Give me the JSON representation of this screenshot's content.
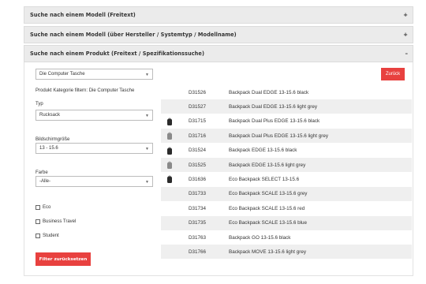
{
  "accordion": [
    {
      "title": "Suche nach einem Modell (Freitext)",
      "toggle": "+"
    },
    {
      "title": "Suche nach einem Modell (über Hersteller / Systemtyp / Modellname)",
      "toggle": "+"
    },
    {
      "title": "Suche nach einem Produkt (Freitext / Spezifikationssuche)",
      "toggle": "–"
    }
  ],
  "filters": {
    "category_select": "Die Computer Tasche",
    "category_filter_text": "Produkt Kategorie filtern: Die Computer Tasche",
    "typ_label": "Typ",
    "typ_value": "Rucksack",
    "screen_label": "Bildschirmgröße",
    "screen_value": "13 - 15.6",
    "color_label": "Farbe",
    "color_value": "-Alle-",
    "checkboxes": [
      "Eco",
      "Business Travel",
      "Student"
    ],
    "reset_label": "Filter zurücksetzen",
    "caret": "▼"
  },
  "back_label": "Zurück",
  "products": [
    {
      "id": "D31526",
      "name": "Backpack Dual EDGE 13-15.6 black",
      "icon": "none"
    },
    {
      "id": "D31527",
      "name": "Backpack Dual EDGE 13-15.6 light grey",
      "icon": "none"
    },
    {
      "id": "D31715",
      "name": "Backpack Dual Plus EDGE 13-15.6 black",
      "icon": "backpack-black-icon"
    },
    {
      "id": "D31716",
      "name": "Backpack Dual Plus EDGE 13-15.6 light grey",
      "icon": "backpack-grey-icon"
    },
    {
      "id": "D31524",
      "name": "Backpack EDGE 13-15.6 black",
      "icon": "backpack-black-icon"
    },
    {
      "id": "D31525",
      "name": "Backpack EDGE 13-15.6 light grey",
      "icon": "backpack-grey-icon"
    },
    {
      "id": "D31636",
      "name": "Eco Backpack SELECT 13-15.6",
      "icon": "backpack-black-icon"
    },
    {
      "id": "D31733",
      "name": "Eco Backpack SCALE 13-15.6 grey",
      "icon": "none"
    },
    {
      "id": "D31734",
      "name": "Eco Backpack SCALE 13-15.6 red",
      "icon": "none"
    },
    {
      "id": "D31735",
      "name": "Eco Backpack SCALE 13-15.6 blue",
      "icon": "none"
    },
    {
      "id": "D31763",
      "name": "Backpack GO 13-15.6 black",
      "icon": "none"
    },
    {
      "id": "D31766",
      "name": "Backpack MOVE 13-15.6 light grey",
      "icon": "none"
    }
  ],
  "colors": {
    "accent": "#e8413f",
    "header_bg": "#ebebeb",
    "row_shade": "#efefef"
  }
}
